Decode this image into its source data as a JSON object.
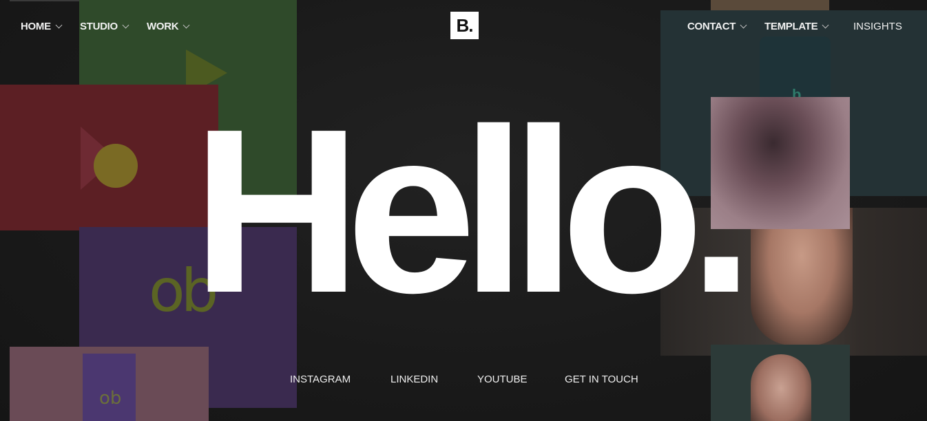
{
  "nav_left": [
    {
      "label": "HOME",
      "icon": "chevron-down-icon"
    },
    {
      "label": "STUDIO",
      "icon": "chevron-down-icon"
    },
    {
      "label": "WORK",
      "icon": "chevron-down-icon"
    }
  ],
  "logo": {
    "text": "B."
  },
  "nav_right": [
    {
      "label": "CONTACT",
      "icon": "chevron-down-icon"
    },
    {
      "label": "TEMPLATE",
      "icon": "chevron-down-icon"
    },
    {
      "label": "INSIGHTS"
    }
  ],
  "hero": {
    "headline": "Hello."
  },
  "social_links": [
    {
      "label": "INSTAGRAM"
    },
    {
      "label": "LINKEDIN"
    },
    {
      "label": "YOUTUBE"
    },
    {
      "label": "GET IN TOUCH"
    }
  ],
  "decor": {
    "mark_large": "ob",
    "mark_small": "ob",
    "mark_b": "b"
  },
  "colors": {
    "background": "#1b1b1b",
    "text": "#ffffff",
    "logo_bg": "#ffffff"
  }
}
